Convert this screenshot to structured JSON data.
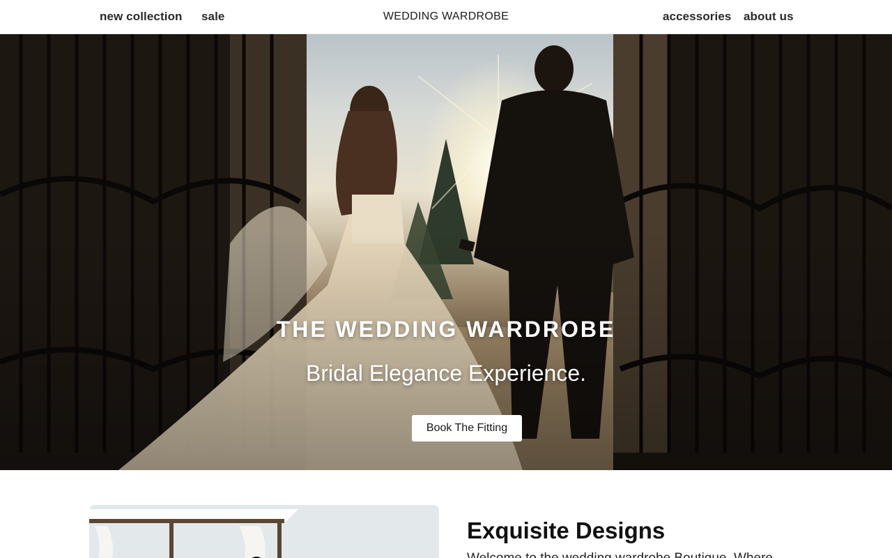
{
  "header": {
    "brand": "WEDDING WARDROBE",
    "nav_left": [
      "new collection",
      "sale"
    ],
    "nav_right": [
      "accessories",
      "about us"
    ]
  },
  "hero": {
    "title": "THE WEDDING WARDROBE",
    "subtitle": "Bridal Elegance Experience.",
    "cta_label": "Book The Fitting"
  },
  "feature": {
    "title": "Exquisite Designs",
    "body": "Welcome to the wedding wardrobe Boutique. Where"
  }
}
